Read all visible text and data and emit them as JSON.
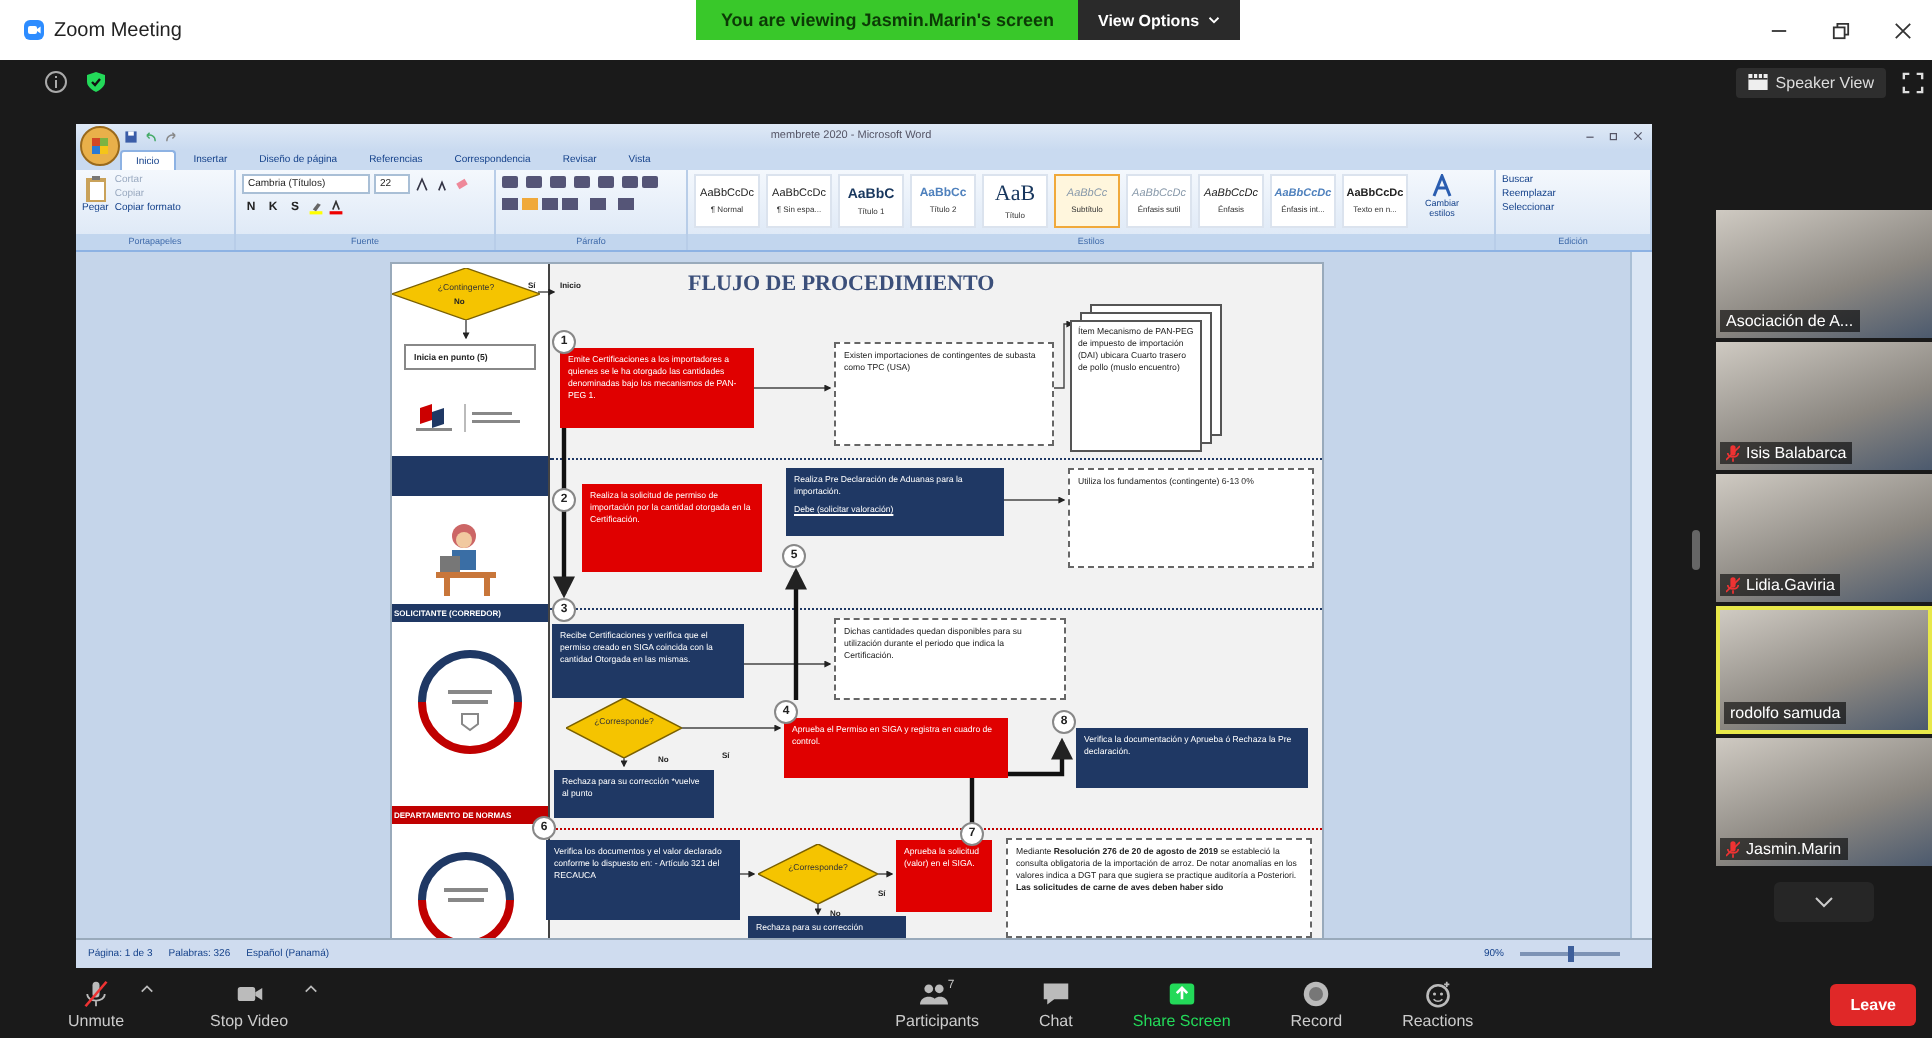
{
  "window": {
    "title": "Zoom Meeting"
  },
  "share_banner": {
    "text": "You are viewing Jasmin.Marin's screen",
    "options": "View Options"
  },
  "view_button": "Speaker View",
  "word": {
    "title": "membrete 2020 - Microsoft Word",
    "tabs": [
      {
        "label": "Inicio",
        "selected": true
      },
      {
        "label": "Insertar",
        "selected": false
      },
      {
        "label": "Diseño de página",
        "selected": false
      },
      {
        "label": "Referencias",
        "selected": false
      },
      {
        "label": "Correspondencia",
        "selected": false
      },
      {
        "label": "Revisar",
        "selected": false
      },
      {
        "label": "Vista",
        "selected": false
      }
    ],
    "clipboard": {
      "paste": "Pegar",
      "items": [
        {
          "label": "Cortar",
          "disabled": true
        },
        {
          "label": "Copiar",
          "disabled": true
        },
        {
          "label": "Copiar formato",
          "disabled": false
        }
      ]
    },
    "font": {
      "family": "Cambria (Títulos)",
      "size": "22",
      "format_buttons": [
        "N",
        "K",
        "S"
      ]
    },
    "styles": [
      {
        "sample": "AaBbCcDc",
        "name": "¶ Normal",
        "kind": "normal",
        "selected": false
      },
      {
        "sample": "AaBbCcDc",
        "name": "¶ Sin espa...",
        "kind": "normal",
        "selected": false
      },
      {
        "sample": "AaBbC",
        "name": "Título 1",
        "kind": "heading1",
        "selected": false
      },
      {
        "sample": "AaBbCc",
        "name": "Título 2",
        "kind": "heading2",
        "selected": false
      },
      {
        "sample": "AaB",
        "name": "Título",
        "kind": "title",
        "selected": false
      },
      {
        "sample": "AaBbCc",
        "name": "Subtítulo",
        "kind": "subtle",
        "selected": true
      },
      {
        "sample": "AaBbCcDc",
        "name": "Énfasis sutil",
        "kind": "subtle",
        "selected": false
      },
      {
        "sample": "AaBbCcDc",
        "name": "Énfasis",
        "kind": "emphasis",
        "selected": false
      },
      {
        "sample": "AaBbCcDc",
        "name": "Énfasis int...",
        "kind": "intense",
        "selected": false
      },
      {
        "sample": "AaBbCcDc",
        "name": "Texto en n...",
        "kind": "strong",
        "selected": false
      }
    ],
    "change_styles": "Cambiar estilos",
    "editing": [
      "Buscar",
      "Reemplazar",
      "Seleccionar"
    ],
    "group_labels": [
      "Portapapeles",
      "Fuente",
      "Párrafo",
      "Estilos",
      "Edición"
    ],
    "flowchart": {
      "title": "FLUJO DE PROCEDIMIENTO",
      "lanes": [
        {
          "text": "SOLICITANTE (CORREDOR)",
          "color": "#1f3864"
        },
        {
          "text": "DEPARTAMENTO DE NORMAS",
          "color": "#c00000"
        }
      ],
      "nodes": [
        {
          "kind": "decision",
          "text": "¿Contingente?"
        },
        {
          "kind": "plain",
          "text": "Inicia en punto (5)"
        },
        {
          "kind": "red",
          "text": "Emite Certificaciones a los importadores a quienes se le ha otorgado las cantidades denominadas bajo los mecanismos de PAN-PEG 1."
        },
        {
          "kind": "note",
          "text": "Existen importaciones de contingentes de subasta como TPC (USA)"
        },
        {
          "kind": "document",
          "text": "Ítem Mecanismo de PAN-PEG de impuesto de importación (DAI) ubicara Cuarto trasero de pollo (muslo encuentro)"
        },
        {
          "kind": "red",
          "text": "Realiza la solicitud de permiso de importación por la cantidad otorgada en la Certificación."
        },
        {
          "kind": "navy",
          "text": "Realiza Pre Declaración de Aduanas para la importación.",
          "subtext": "Debe (solicitar valoración)"
        },
        {
          "kind": "note",
          "text": "Utiliza los fundamentos (contingente) 6-13 0%"
        },
        {
          "kind": "navy",
          "text": "Recibe Certificaciones y verifica que el permiso creado en SIGA coincida con la cantidad Otorgada en las mismas."
        },
        {
          "kind": "note",
          "text": "Dichas cantidades quedan disponibles para su utilización durante el periodo que indica la Certificación."
        },
        {
          "kind": "decision",
          "text": "¿Corresponde?"
        },
        {
          "kind": "navy",
          "text": "Rechaza para su corrección *vuelve al punto"
        },
        {
          "kind": "red",
          "text": "Aprueba el Permiso en SIGA y registra en cuadro de control."
        },
        {
          "kind": "navy",
          "text": "Verifica la documentación y Aprueba ó Rechaza la Pre declaración."
        },
        {
          "kind": "navy",
          "text": "Verifica los documentos y el valor declarado conforme lo dispuesto en: - Artículo 321 del RECAUCA"
        },
        {
          "kind": "decision",
          "text": "¿Corresponde?"
        },
        {
          "kind": "red",
          "text": "Aprueba la solicitud (valor) en el SIGA."
        },
        {
          "kind": "navy",
          "text": "Rechaza para su corrección"
        },
        {
          "kind": "note",
          "text": "Mediante **Resolución 276 de 20 de agosto de 2019** se estableció la consulta obligatoria de la importación de arroz. De notar anomalías en los valores indica a DGT para que sugiera se practique auditoría a Posteriori. **Las solicitudes de carne de aves deben haber sido**"
        }
      ],
      "steps": [
        "1",
        "2",
        "3",
        "4",
        "5",
        "6",
        "7",
        "8"
      ],
      "labels": [
        "No",
        "Sí",
        "Inicio",
        "No",
        "Sí",
        "Sí",
        "No"
      ]
    },
    "status_bar": {
      "page": "Página: 1 de 3",
      "words": "Palabras: 326",
      "language": "Español (Panamá)",
      "zoom": "90%",
      "level": 0.5
    }
  },
  "participants": [
    {
      "name": "Asociación de A...",
      "muted": false,
      "selected": false
    },
    {
      "name": "Isis Balabarca",
      "muted": true,
      "selected": false
    },
    {
      "name": "Lidia.Gaviria",
      "muted": true,
      "selected": false
    },
    {
      "name": "rodolfo samuda",
      "muted": false,
      "selected": true
    },
    {
      "name": "Jasmin.Marin",
      "muted": true,
      "selected": false
    }
  ],
  "toolbar": {
    "mute": "Unmute",
    "video": "Stop Video",
    "participants": "Participants",
    "participant_count": "7",
    "chat": "Chat",
    "share": "Share Screen",
    "record": "Record",
    "reactions": "Reactions",
    "leave": "Leave"
  }
}
